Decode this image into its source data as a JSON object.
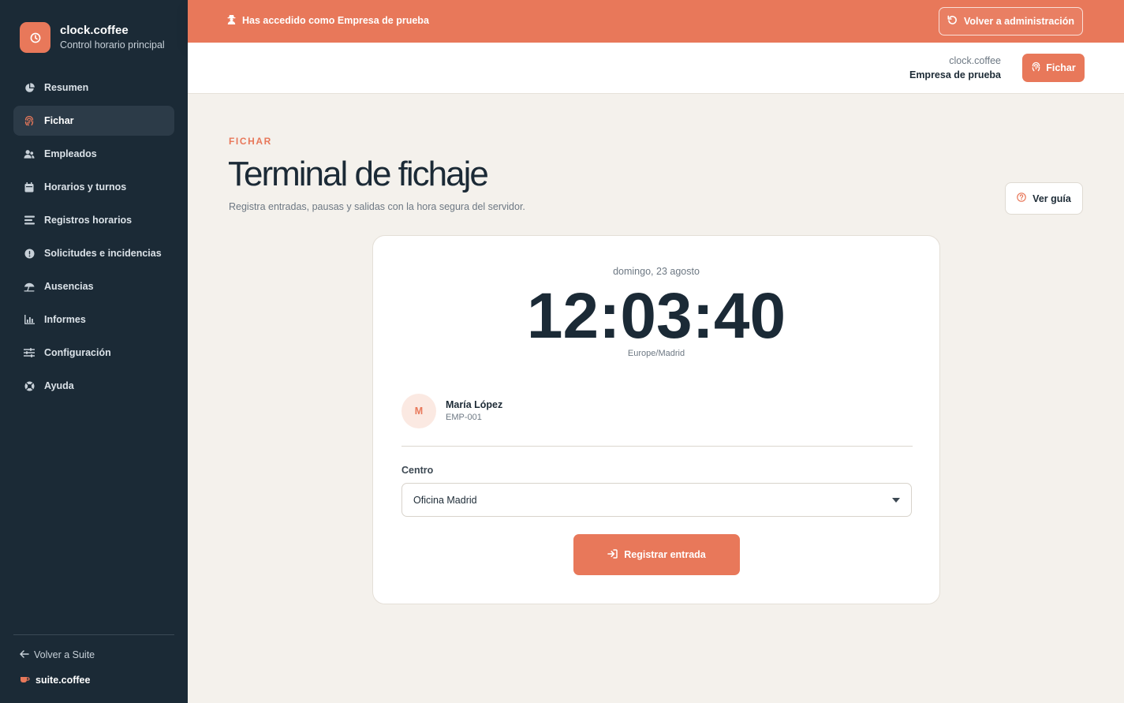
{
  "brand": {
    "name": "clock.coffee",
    "subtitle": "Control horario principal",
    "accent": "#e8785a",
    "sidebar_bg": "#1b2a36"
  },
  "sidebar": {
    "items": [
      {
        "label": "Resumen",
        "icon": "pie-chart-icon",
        "active": false
      },
      {
        "label": "Fichar",
        "icon": "fingerprint-icon",
        "active": true
      },
      {
        "label": "Empleados",
        "icon": "users-icon",
        "active": false
      },
      {
        "label": "Horarios y turnos",
        "icon": "calendar-icon",
        "active": false
      },
      {
        "label": "Registros horarios",
        "icon": "list-icon",
        "active": false
      },
      {
        "label": "Solicitudes e incidencias",
        "icon": "alert-circle-icon",
        "active": false
      },
      {
        "label": "Ausencias",
        "icon": "umbrella-beach-icon",
        "active": false
      },
      {
        "label": "Informes",
        "icon": "bar-chart-icon",
        "active": false
      },
      {
        "label": "Configuración",
        "icon": "sliders-icon",
        "active": false
      },
      {
        "label": "Ayuda",
        "icon": "lifebuoy-icon",
        "active": false
      }
    ],
    "back_label": "Volver a Suite",
    "suite_label": "suite.coffee"
  },
  "banner": {
    "message": "Has accedido como Empresa de prueba",
    "return_label": "Volver a administración"
  },
  "header": {
    "app_name": "clock.coffee",
    "company": "Empresa de prueba",
    "fichar_label": "Fichar"
  },
  "page": {
    "eyebrow": "FICHAR",
    "title": "Terminal de fichaje",
    "subtitle": "Registra entradas, pausas y salidas con la hora segura del servidor.",
    "guide_label": "Ver guía"
  },
  "terminal": {
    "date": "domingo, 23 agosto",
    "time": "12:03:40",
    "timezone": "Europe/Madrid",
    "employee": {
      "initial": "M",
      "name": "María López",
      "code": "EMP-001"
    },
    "center_label": "Centro",
    "center_value": "Oficina Madrid",
    "register_label": "Registrar entrada"
  }
}
